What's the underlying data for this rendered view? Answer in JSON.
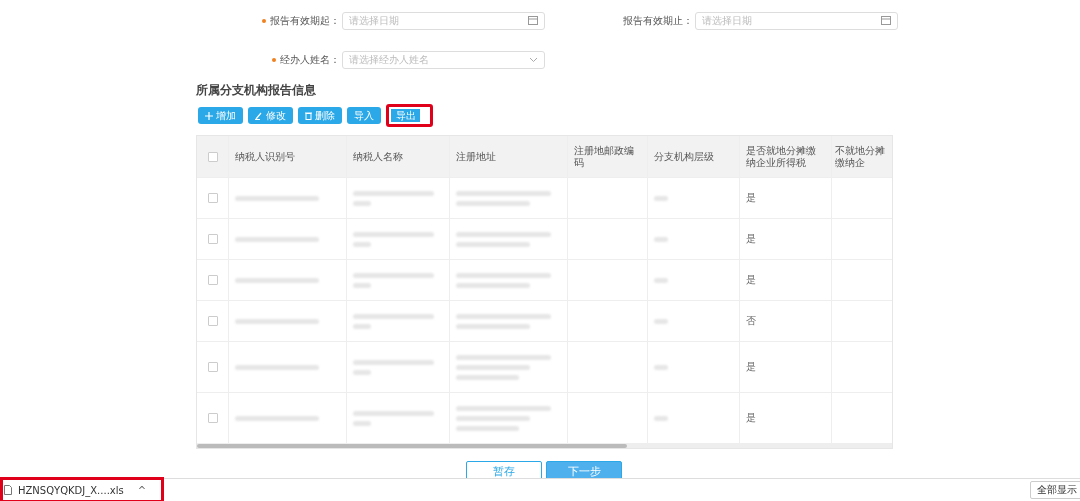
{
  "form": {
    "fields": [
      {
        "label": "报告有效期起：",
        "required": true,
        "placeholder": "请选择日期",
        "kind": "date"
      },
      {
        "label": "报告有效期止：",
        "required": false,
        "placeholder": "请选择日期",
        "kind": "date"
      },
      {
        "label": "经办人姓名：",
        "required": true,
        "placeholder": "请选择经办人姓名",
        "kind": "select"
      }
    ]
  },
  "section_title": "所属分支机构报告信息",
  "toolbar": [
    {
      "label": "增加",
      "kind": "add",
      "highlighted": false
    },
    {
      "label": "修改",
      "kind": "edit",
      "highlighted": false
    },
    {
      "label": "删除",
      "kind": "delete",
      "highlighted": false
    },
    {
      "label": "导入",
      "kind": "import",
      "highlighted": false
    },
    {
      "label": "导出",
      "kind": "export",
      "highlighted": true
    }
  ],
  "table": {
    "all_checked": false,
    "columns": [
      "纳税人识别号",
      "纳税人名称",
      "注册地址",
      "注册地邮政编码",
      "分支机构层级",
      "是否就地分摊缴纳企业所得税",
      "不就地分摊缴纳企"
    ],
    "rows": [
      {
        "checked": false,
        "tall": false,
        "column_7": "是"
      },
      {
        "checked": false,
        "tall": false,
        "column_7": "是"
      },
      {
        "checked": false,
        "tall": false,
        "column_7": "是"
      },
      {
        "checked": false,
        "tall": false,
        "column_7": "否"
      },
      {
        "checked": false,
        "tall": true,
        "column_7": "是"
      },
      {
        "checked": false,
        "tall": true,
        "column_7": "是"
      }
    ]
  },
  "footer_buttons": [
    {
      "label": "暂存",
      "primary": false
    },
    {
      "label": "下一步",
      "primary": true
    }
  ],
  "download_bar": {
    "file": "HZNSQYQKDJ_X....xls",
    "caret": "^",
    "highlighted": true,
    "show_all": "全部显示"
  }
}
